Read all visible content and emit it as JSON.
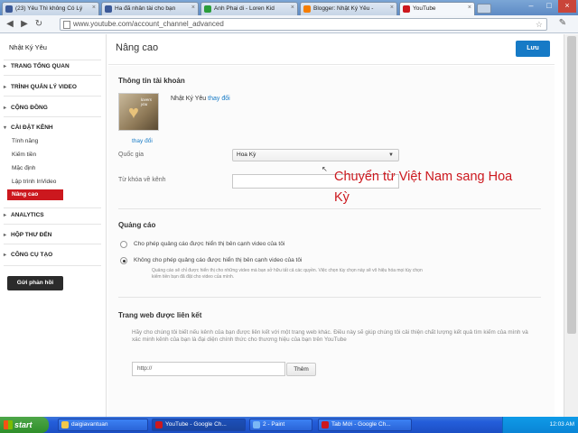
{
  "browser": {
    "tabs": [
      {
        "title": "(23) Yêu Thì không Có Lý",
        "icon_color": "#3b5998"
      },
      {
        "title": "Ha đã nhân tài cho bạn",
        "icon_color": "#3b5998"
      },
      {
        "title": "Anh Phai di - Loren Kid",
        "icon_color": "#2a9d3a"
      },
      {
        "title": "Blogger: Nhật Ký Yêu -",
        "icon_color": "#f57d00"
      },
      {
        "title": "YouTube",
        "icon_color": "#cc181e"
      }
    ],
    "url": "www.youtube.com/account_channel_advanced"
  },
  "sidebar": {
    "channel_name": "Nhật Ký Yêu",
    "items": [
      {
        "label": "TRANG TỔNG QUAN"
      },
      {
        "label": "TRÌNH QUẢN LÝ VIDEO"
      },
      {
        "label": "CỘNG ĐỒNG"
      },
      {
        "label": "CÀI ĐẶT KÊNH"
      },
      {
        "label": "ANALYTICS"
      },
      {
        "label": "HỘP THƯ ĐẾN"
      },
      {
        "label": "CÔNG CỤ TẠO"
      }
    ],
    "sub_items": [
      {
        "label": "Tính năng"
      },
      {
        "label": "Kiếm tiền"
      },
      {
        "label": "Mặc định"
      },
      {
        "label": "Lập trình InVideo"
      },
      {
        "label": "Nâng cao"
      }
    ],
    "feedback_label": "Gửi phản hồi"
  },
  "header": {
    "title": "Nâng cao",
    "save_label": "Lưu"
  },
  "account": {
    "section_title": "Thông tin tài khoản",
    "name": "Nhật Ký Yêu",
    "change_link": "thay đổi",
    "thumb_change_link": "thay đổi",
    "thumb_caption": "lovers you",
    "country_label": "Quốc gia",
    "country_value": "Hoa Kỳ",
    "keywords_label": "Từ khóa về kênh"
  },
  "annotation": {
    "text": "Chuyển từ Việt Nam sang Hoa Kỳ"
  },
  "ads": {
    "section_title": "Quảng cáo",
    "option_allow": "Cho phép quảng cáo được hiển thị bên cạnh video của tôi",
    "option_disallow": "Không cho phép quảng cáo được hiển thị bên cạnh video của tôi",
    "hint": "Quảng cáo sẽ chỉ được hiển thị cho những video mà bạn sở hữu tất cả các quyền. Việc chọn tùy chọn này sẽ vô hiệu hóa mọi tùy chọn kiếm tiền bạn đã đặt cho video của mình.",
    "selected": "disallow"
  },
  "website": {
    "section_title": "Trang web được liên kết",
    "description": "Hãy cho chúng tôi biết nếu kênh của bạn được liên kết với một trang web khác. Điều này sẽ giúp chúng tôi cải thiện chất lượng kết quả tìm kiếm của mình và xác minh kênh của bạn là đại diện chính thức cho thương hiệu của bạn trên YouTube",
    "url_placeholder": "http://",
    "add_label": "Thêm"
  },
  "taskbar": {
    "start_label": "start",
    "tasks": [
      {
        "label": "daigiavantuan",
        "icon_color": "#f2c94c"
      },
      {
        "label": "YouTube - Google Ch...",
        "icon_color": "#cc181e"
      },
      {
        "label": "2 - Paint",
        "icon_color": "#7ab8f5"
      },
      {
        "label": "Tab Mới - Google Ch...",
        "icon_color": "#cc181e"
      }
    ],
    "clock": "12:03 AM"
  }
}
